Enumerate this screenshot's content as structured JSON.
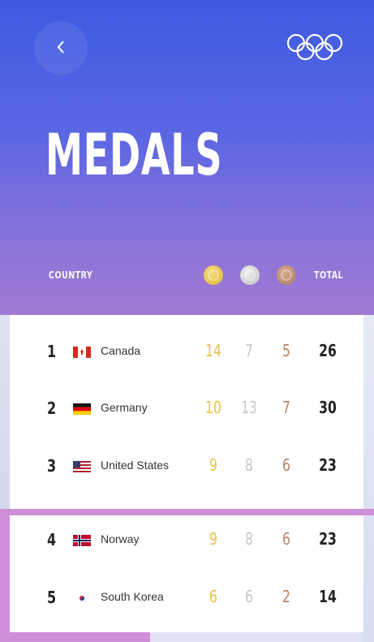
{
  "header": {
    "title": "MEDALS",
    "back_icon": "chevron-left-icon",
    "logo_icon": "olympic-rings-icon"
  },
  "columns": {
    "country": "COUNTRY",
    "total": "TOTAL",
    "gold_icon": "gold-medal-icon",
    "silver_icon": "silver-medal-icon",
    "bronze_icon": "bronze-medal-icon"
  },
  "rows": [
    {
      "rank": "1",
      "country": "Canada",
      "flag": "canada-flag-icon",
      "gold": "14",
      "silver": "7",
      "bronze": "5",
      "total": "26"
    },
    {
      "rank": "2",
      "country": "Germany",
      "flag": "germany-flag-icon",
      "gold": "10",
      "silver": "13",
      "bronze": "7",
      "total": "30"
    },
    {
      "rank": "3",
      "country": "United States",
      "flag": "usa-flag-icon",
      "gold": "9",
      "silver": "8",
      "bronze": "6",
      "total": "23"
    },
    {
      "rank": "4",
      "country": "Norway",
      "flag": "norway-flag-icon",
      "gold": "9",
      "silver": "8",
      "bronze": "6",
      "total": "23"
    },
    {
      "rank": "5",
      "country": "South Korea",
      "flag": "south-korea-flag-icon",
      "gold": "6",
      "silver": "6",
      "bronze": "2",
      "total": "14"
    }
  ],
  "colors": {
    "header_top": "#3c5ae1",
    "header_bottom": "#a07ad2",
    "gold": "#eac23e",
    "silver": "#c7c7c7",
    "bronze": "#b88364",
    "highlight": "#cf8fd8"
  }
}
